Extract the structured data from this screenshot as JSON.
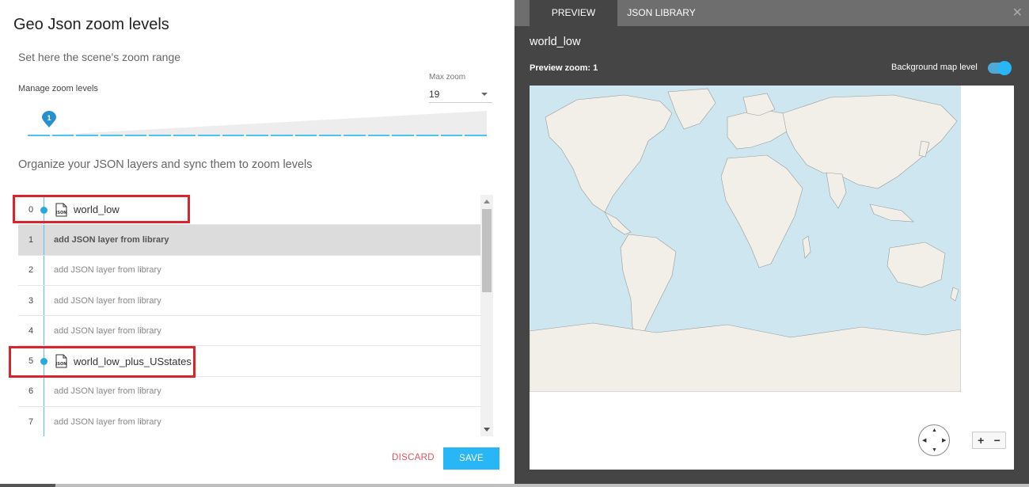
{
  "left": {
    "title": "Geo Json zoom levels",
    "subtitle": "Set here the scene's zoom range",
    "manage_label": "Manage zoom levels",
    "max_zoom_label": "Max zoom",
    "max_zoom_value": "19",
    "zoom_handle_value": "1",
    "organize_label": "Organize your JSON layers and sync them to zoom levels",
    "layers": [
      {
        "index": "0",
        "name": "world_low",
        "label": ""
      },
      {
        "index": "1",
        "name": "",
        "label": "add JSON layer from library"
      },
      {
        "index": "2",
        "name": "",
        "label": "add JSON layer from library"
      },
      {
        "index": "3",
        "name": "",
        "label": "add JSON layer from library"
      },
      {
        "index": "4",
        "name": "",
        "label": "add JSON layer from library"
      },
      {
        "index": "5",
        "name": "world_low_plus_USstates",
        "label": ""
      },
      {
        "index": "6",
        "name": "",
        "label": "add JSON layer from library"
      },
      {
        "index": "7",
        "name": "",
        "label": "add JSON layer from library"
      }
    ],
    "json_icon_text": "JSON",
    "discard_label": "DISCARD",
    "save_label": "SAVE"
  },
  "right": {
    "tabs": [
      "PREVIEW",
      "JSON LIBRARY"
    ],
    "close_icon": "close-icon",
    "layer_title": "world_low",
    "preview_zoom": "Preview zoom: 1",
    "bg_map_label": "Background map level",
    "zoom_in": "+",
    "zoom_out": "−"
  },
  "colors": {
    "accent": "#29b6f6",
    "highlight": "#d9232d",
    "ocean": "#cde6ef",
    "land": "#f2efe9"
  }
}
